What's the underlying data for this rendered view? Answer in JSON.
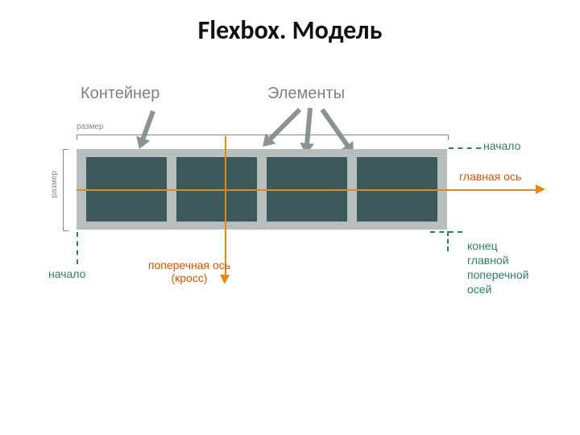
{
  "title": "Flexbox. Модель",
  "labels": {
    "container": "Контейнер",
    "elements": "Элементы",
    "size_h": "размер",
    "size_v": "размер",
    "main_axis": "главная ось",
    "cross_axis_1": "поперечная ось",
    "cross_axis_2": "(кросс)",
    "start_main": "начало",
    "start_cross": "начало",
    "end_combo_1": "конец",
    "end_combo_2": "главной",
    "end_combo_3": "поперечной",
    "end_combo_4": "осей"
  },
  "chart_data": {
    "type": "diagram",
    "title": "Flexbox. Модель",
    "container": "Контейнер",
    "items_count": 4,
    "elements_label": "Элементы",
    "main_axis": {
      "label": "главная ось",
      "direction": "horizontal",
      "start_label": "начало"
    },
    "cross_axis": {
      "label": "поперечная ось (кросс)",
      "direction": "vertical",
      "start_label": "начало"
    },
    "end_label": "конец главной поперечной осей",
    "main_size_label": "размер",
    "cross_size_label": "размер"
  }
}
